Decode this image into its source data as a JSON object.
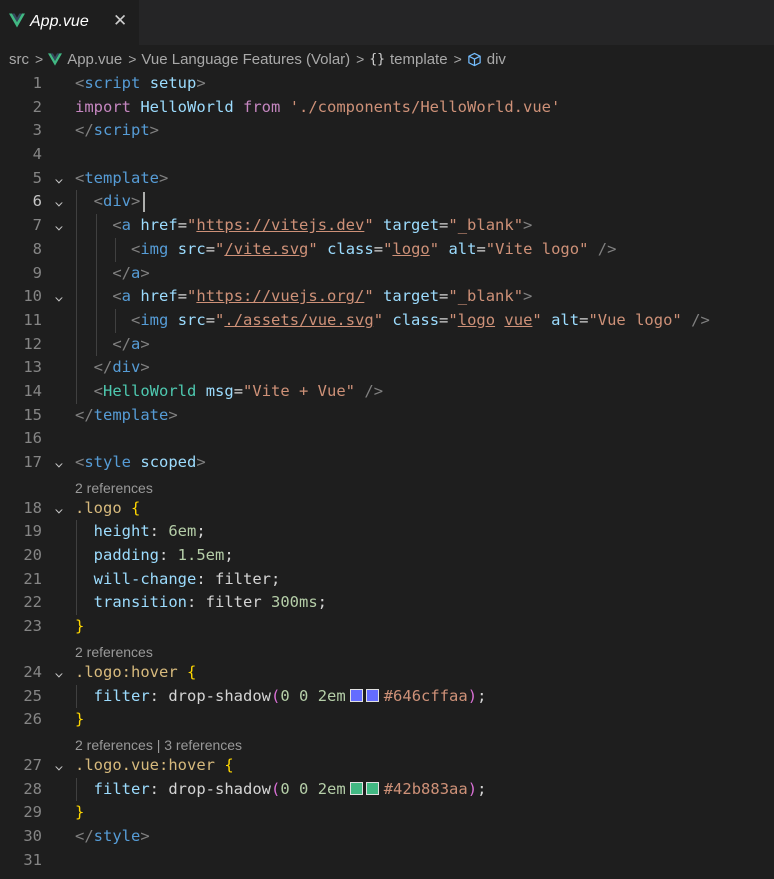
{
  "tab": {
    "title": "App.vue",
    "close_glyph": "✕"
  },
  "breadcrumb": {
    "items": [
      "src",
      "App.vue",
      "Vue Language Features (Volar)",
      "template",
      "div"
    ],
    "separator": ">"
  },
  "code_lens": {
    "l18": "2 references",
    "l24": "2 references",
    "l27": "2 references | 3 references"
  },
  "swatch_colors": {
    "c1": "#646cff",
    "c2": "#42b883"
  },
  "lines": [
    {
      "n": "1",
      "fold": "",
      "indent": "",
      "tokens": [
        {
          "c": "t-punc",
          "t": "<"
        },
        {
          "c": "t-tag",
          "t": "script"
        },
        {
          "c": "t-white",
          "t": " "
        },
        {
          "c": "t-attr",
          "t": "setup"
        },
        {
          "c": "t-punc",
          "t": ">"
        }
      ]
    },
    {
      "n": "2",
      "fold": "",
      "indent": "",
      "tokens": [
        {
          "c": "t-kw",
          "t": "import"
        },
        {
          "c": "t-white",
          "t": " "
        },
        {
          "c": "t-attr",
          "t": "HelloWorld"
        },
        {
          "c": "t-white",
          "t": " "
        },
        {
          "c": "t-kw",
          "t": "from"
        },
        {
          "c": "t-white",
          "t": " "
        },
        {
          "c": "t-str",
          "t": "'./components/HelloWorld.vue'"
        }
      ]
    },
    {
      "n": "3",
      "fold": "",
      "indent": "",
      "tokens": [
        {
          "c": "t-punc",
          "t": "</"
        },
        {
          "c": "t-tag",
          "t": "script"
        },
        {
          "c": "t-punc",
          "t": ">"
        }
      ]
    },
    {
      "n": "4",
      "fold": "",
      "indent": "",
      "tokens": []
    },
    {
      "n": "5",
      "fold": "⌄",
      "indent": "",
      "tokens": [
        {
          "c": "t-punc",
          "t": "<"
        },
        {
          "c": "t-tag",
          "t": "template"
        },
        {
          "c": "t-punc",
          "t": ">"
        }
      ]
    },
    {
      "n": "6",
      "fold": "⌄",
      "indent": "  ",
      "current": true,
      "tokens": [
        {
          "c": "t-punc",
          "t": "<"
        },
        {
          "c": "t-tag",
          "t": "div"
        },
        {
          "c": "t-punc",
          "t": ">"
        }
      ]
    },
    {
      "n": "7",
      "fold": "⌄",
      "indent": "    ",
      "tokens": [
        {
          "c": "t-punc",
          "t": "<"
        },
        {
          "c": "t-tag",
          "t": "a"
        },
        {
          "c": "t-white",
          "t": " "
        },
        {
          "c": "t-attr",
          "t": "href"
        },
        {
          "c": "t-white",
          "t": "="
        },
        {
          "c": "t-str",
          "t": "\""
        },
        {
          "c": "t-str t-und",
          "t": "https://vitejs.dev"
        },
        {
          "c": "t-str",
          "t": "\""
        },
        {
          "c": "t-white",
          "t": " "
        },
        {
          "c": "t-attr",
          "t": "target"
        },
        {
          "c": "t-white",
          "t": "="
        },
        {
          "c": "t-str",
          "t": "\"_blank\""
        },
        {
          "c": "t-punc",
          "t": ">"
        }
      ]
    },
    {
      "n": "8",
      "fold": "",
      "indent": "      ",
      "tokens": [
        {
          "c": "t-punc",
          "t": "<"
        },
        {
          "c": "t-tag",
          "t": "img"
        },
        {
          "c": "t-white",
          "t": " "
        },
        {
          "c": "t-attr",
          "t": "src"
        },
        {
          "c": "t-white",
          "t": "="
        },
        {
          "c": "t-str",
          "t": "\""
        },
        {
          "c": "t-str t-und",
          "t": "/vite.svg"
        },
        {
          "c": "t-str",
          "t": "\""
        },
        {
          "c": "t-white",
          "t": " "
        },
        {
          "c": "t-attr",
          "t": "class"
        },
        {
          "c": "t-white",
          "t": "="
        },
        {
          "c": "t-str",
          "t": "\""
        },
        {
          "c": "t-str t-und",
          "t": "logo"
        },
        {
          "c": "t-str",
          "t": "\""
        },
        {
          "c": "t-white",
          "t": " "
        },
        {
          "c": "t-attr",
          "t": "alt"
        },
        {
          "c": "t-white",
          "t": "="
        },
        {
          "c": "t-str",
          "t": "\"Vite logo\""
        },
        {
          "c": "t-white",
          "t": " "
        },
        {
          "c": "t-punc",
          "t": "/>"
        }
      ]
    },
    {
      "n": "9",
      "fold": "",
      "indent": "    ",
      "tokens": [
        {
          "c": "t-punc",
          "t": "</"
        },
        {
          "c": "t-tag",
          "t": "a"
        },
        {
          "c": "t-punc",
          "t": ">"
        }
      ]
    },
    {
      "n": "10",
      "fold": "⌄",
      "indent": "    ",
      "tokens": [
        {
          "c": "t-punc",
          "t": "<"
        },
        {
          "c": "t-tag",
          "t": "a"
        },
        {
          "c": "t-white",
          "t": " "
        },
        {
          "c": "t-attr",
          "t": "href"
        },
        {
          "c": "t-white",
          "t": "="
        },
        {
          "c": "t-str",
          "t": "\""
        },
        {
          "c": "t-str t-und",
          "t": "https://vuejs.org/"
        },
        {
          "c": "t-str",
          "t": "\""
        },
        {
          "c": "t-white",
          "t": " "
        },
        {
          "c": "t-attr",
          "t": "target"
        },
        {
          "c": "t-white",
          "t": "="
        },
        {
          "c": "t-str",
          "t": "\"_blank\""
        },
        {
          "c": "t-punc",
          "t": ">"
        }
      ]
    },
    {
      "n": "11",
      "fold": "",
      "indent": "      ",
      "tokens": [
        {
          "c": "t-punc",
          "t": "<"
        },
        {
          "c": "t-tag",
          "t": "img"
        },
        {
          "c": "t-white",
          "t": " "
        },
        {
          "c": "t-attr",
          "t": "src"
        },
        {
          "c": "t-white",
          "t": "="
        },
        {
          "c": "t-str",
          "t": "\""
        },
        {
          "c": "t-str t-und",
          "t": "./assets/vue.svg"
        },
        {
          "c": "t-str",
          "t": "\""
        },
        {
          "c": "t-white",
          "t": " "
        },
        {
          "c": "t-attr",
          "t": "class"
        },
        {
          "c": "t-white",
          "t": "="
        },
        {
          "c": "t-str",
          "t": "\""
        },
        {
          "c": "t-str t-und",
          "t": "logo"
        },
        {
          "c": "t-str",
          "t": " "
        },
        {
          "c": "t-str t-und",
          "t": "vue"
        },
        {
          "c": "t-str",
          "t": "\""
        },
        {
          "c": "t-white",
          "t": " "
        },
        {
          "c": "t-attr",
          "t": "alt"
        },
        {
          "c": "t-white",
          "t": "="
        },
        {
          "c": "t-str",
          "t": "\"Vue logo\""
        },
        {
          "c": "t-white",
          "t": " "
        },
        {
          "c": "t-punc",
          "t": "/>"
        }
      ]
    },
    {
      "n": "12",
      "fold": "",
      "indent": "    ",
      "tokens": [
        {
          "c": "t-punc",
          "t": "</"
        },
        {
          "c": "t-tag",
          "t": "a"
        },
        {
          "c": "t-punc",
          "t": ">"
        }
      ]
    },
    {
      "n": "13",
      "fold": "",
      "indent": "  ",
      "tokens": [
        {
          "c": "t-punc",
          "t": "</"
        },
        {
          "c": "t-tag",
          "t": "div"
        },
        {
          "c": "t-punc",
          "t": ">"
        }
      ]
    },
    {
      "n": "14",
      "fold": "",
      "indent": "  ",
      "tokens": [
        {
          "c": "t-punc",
          "t": "<"
        },
        {
          "c": "t-comp",
          "t": "HelloWorld"
        },
        {
          "c": "t-white",
          "t": " "
        },
        {
          "c": "t-attr",
          "t": "msg"
        },
        {
          "c": "t-white",
          "t": "="
        },
        {
          "c": "t-str",
          "t": "\"Vite + Vue\""
        },
        {
          "c": "t-white",
          "t": " "
        },
        {
          "c": "t-punc",
          "t": "/>"
        }
      ]
    },
    {
      "n": "15",
      "fold": "",
      "indent": "",
      "tokens": [
        {
          "c": "t-punc",
          "t": "</"
        },
        {
          "c": "t-tag",
          "t": "template"
        },
        {
          "c": "t-punc",
          "t": ">"
        }
      ]
    },
    {
      "n": "16",
      "fold": "",
      "indent": "",
      "tokens": []
    },
    {
      "n": "17",
      "fold": "⌄",
      "indent": "",
      "tokens": [
        {
          "c": "t-punc",
          "t": "<"
        },
        {
          "c": "t-tag",
          "t": "style"
        },
        {
          "c": "t-white",
          "t": " "
        },
        {
          "c": "t-attr",
          "t": "scoped"
        },
        {
          "c": "t-punc",
          "t": ">"
        }
      ]
    },
    {
      "lens": "l18"
    },
    {
      "n": "18",
      "fold": "⌄",
      "indent": "",
      "tokens": [
        {
          "c": "t-sel",
          "t": ".logo"
        },
        {
          "c": "t-white",
          "t": " "
        },
        {
          "c": "t-br",
          "t": "{"
        }
      ]
    },
    {
      "n": "19",
      "fold": "",
      "indent": "  ",
      "tokens": [
        {
          "c": "t-attr",
          "t": "height"
        },
        {
          "c": "t-white",
          "t": ": "
        },
        {
          "c": "t-num",
          "t": "6em"
        },
        {
          "c": "t-white",
          "t": ";"
        }
      ]
    },
    {
      "n": "20",
      "fold": "",
      "indent": "  ",
      "tokens": [
        {
          "c": "t-attr",
          "t": "padding"
        },
        {
          "c": "t-white",
          "t": ": "
        },
        {
          "c": "t-num",
          "t": "1.5em"
        },
        {
          "c": "t-white",
          "t": ";"
        }
      ]
    },
    {
      "n": "21",
      "fold": "",
      "indent": "  ",
      "tokens": [
        {
          "c": "t-attr",
          "t": "will-change"
        },
        {
          "c": "t-white",
          "t": ": filter;"
        }
      ]
    },
    {
      "n": "22",
      "fold": "",
      "indent": "  ",
      "tokens": [
        {
          "c": "t-attr",
          "t": "transition"
        },
        {
          "c": "t-white",
          "t": ": filter "
        },
        {
          "c": "t-num",
          "t": "300ms"
        },
        {
          "c": "t-white",
          "t": ";"
        }
      ]
    },
    {
      "n": "23",
      "fold": "",
      "indent": "",
      "tokens": [
        {
          "c": "t-br",
          "t": "}"
        }
      ]
    },
    {
      "lens": "l24"
    },
    {
      "n": "24",
      "fold": "⌄",
      "indent": "",
      "tokens": [
        {
          "c": "t-sel",
          "t": ".logo:hover"
        },
        {
          "c": "t-white",
          "t": " "
        },
        {
          "c": "t-br",
          "t": "{"
        }
      ]
    },
    {
      "n": "25",
      "fold": "",
      "indent": "  ",
      "tokens": [
        {
          "c": "t-attr",
          "t": "filter"
        },
        {
          "c": "t-white",
          "t": ": drop-shadow"
        },
        {
          "c": "t-br2",
          "t": "("
        },
        {
          "c": "t-num",
          "t": "0"
        },
        {
          "c": "t-white",
          "t": " "
        },
        {
          "c": "t-num",
          "t": "0"
        },
        {
          "c": "t-white",
          "t": " "
        },
        {
          "c": "t-num",
          "t": "2em"
        },
        {
          "sw": "c1"
        },
        {
          "c": "t-str",
          "t": "#646cffaa"
        },
        {
          "c": "t-br2",
          "t": ")"
        },
        {
          "c": "t-white",
          "t": ";"
        }
      ]
    },
    {
      "n": "26",
      "fold": "",
      "indent": "",
      "tokens": [
        {
          "c": "t-br",
          "t": "}"
        }
      ]
    },
    {
      "lens": "l27"
    },
    {
      "n": "27",
      "fold": "⌄",
      "indent": "",
      "tokens": [
        {
          "c": "t-sel",
          "t": ".logo.vue:hover"
        },
        {
          "c": "t-white",
          "t": " "
        },
        {
          "c": "t-br",
          "t": "{"
        }
      ]
    },
    {
      "n": "28",
      "fold": "",
      "indent": "  ",
      "tokens": [
        {
          "c": "t-attr",
          "t": "filter"
        },
        {
          "c": "t-white",
          "t": ": drop-shadow"
        },
        {
          "c": "t-br2",
          "t": "("
        },
        {
          "c": "t-num",
          "t": "0"
        },
        {
          "c": "t-white",
          "t": " "
        },
        {
          "c": "t-num",
          "t": "0"
        },
        {
          "c": "t-white",
          "t": " "
        },
        {
          "c": "t-num",
          "t": "2em"
        },
        {
          "sw": "c2"
        },
        {
          "c": "t-str",
          "t": "#42b883aa"
        },
        {
          "c": "t-br2",
          "t": ")"
        },
        {
          "c": "t-white",
          "t": ";"
        }
      ]
    },
    {
      "n": "29",
      "fold": "",
      "indent": "",
      "tokens": [
        {
          "c": "t-br",
          "t": "}"
        }
      ]
    },
    {
      "n": "30",
      "fold": "",
      "indent": "",
      "tokens": [
        {
          "c": "t-punc",
          "t": "</"
        },
        {
          "c": "t-tag",
          "t": "style"
        },
        {
          "c": "t-punc",
          "t": ">"
        }
      ]
    },
    {
      "n": "31",
      "fold": "",
      "indent": "",
      "tokens": []
    }
  ]
}
